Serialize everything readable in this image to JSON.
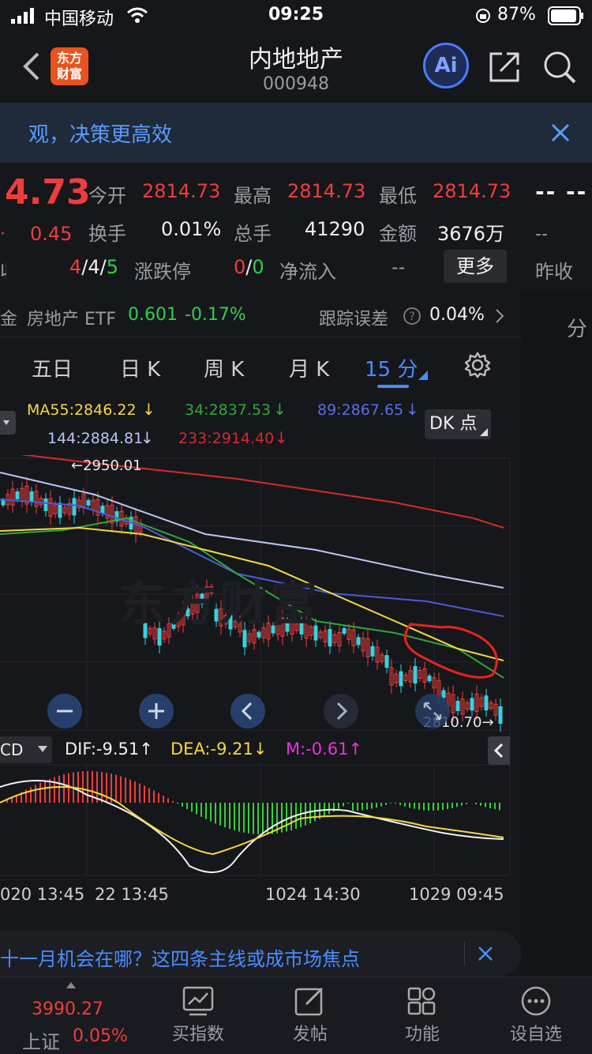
{
  "status": {
    "carrier": "中国移动",
    "time": "09:25",
    "battery": "87%"
  },
  "header": {
    "title": "内地地产",
    "code": "000948",
    "logo_line1": "东方",
    "logo_line2": "财富",
    "ai_label": "Ai"
  },
  "banner": {
    "text": "观，决策更高效"
  },
  "quote": {
    "price": "4.73",
    "change": "0.45",
    "open_label": "今开",
    "open": "2814.73",
    "high_label": "最高",
    "high": "2814.73",
    "low_label": "最低",
    "low": "2814.73",
    "turnover_label": "换手",
    "turnover": "0.01%",
    "volume_label": "总手",
    "volume": "41290",
    "amount_label": "金额",
    "amount": "3676万",
    "ratio_a": "4",
    "ratio_b": "4",
    "ratio_c": "5",
    "limit_label": "涨跌停",
    "limit_a": "0",
    "limit_b": "0",
    "netflow_label": "净流入",
    "netflow": "--",
    "more_label": "更多",
    "right_top": "-- --",
    "right_mid": "--",
    "prev_close_label": "昨收",
    "left_cut": "收"
  },
  "etf": {
    "prefix": "金",
    "name": "房地产 ETF",
    "price": "0.601",
    "pct": "-0.17%",
    "err_label": "跟踪误差",
    "err_value": "0.04%",
    "right_cut": "分"
  },
  "tabs": [
    {
      "label": "五日"
    },
    {
      "label": "日 K"
    },
    {
      "label": "周 K"
    },
    {
      "label": "月 K"
    },
    {
      "label": "15 分"
    }
  ],
  "ma": {
    "ma55": "MA55:2846.22",
    "ma34": "34:2837.53",
    "ma89": "89:2867.65",
    "ma144": "144:2884.81",
    "ma233": "233:2914.40",
    "dk_label": "DK 点",
    "colors": {
      "ma55": "#f5d742",
      "ma34": "#2fa83a",
      "ma89": "#4a5bd8",
      "ma144": "#b9c6f2",
      "ma233": "#d62a2a"
    }
  },
  "chart": {
    "high_marker": "2950.01",
    "low_marker": "2810.70",
    "watermark": "东方财富",
    "macd_label": "CD",
    "dif": "DIF:-9.51",
    "dea": "DEA:-9.21",
    "m": "M:-0.61",
    "time_labels": [
      "020 13:45",
      "22 13:45",
      "1024 14:30",
      "1029 09:45"
    ],
    "controls": [
      "zoom-out",
      "zoom-in",
      "prev",
      "next"
    ]
  },
  "news": {
    "text": "十一月机会在哪？这四条主线或成市场焦点"
  },
  "bottom": {
    "index_value": "3990.27",
    "index_name": "上证",
    "index_pct": "0.05%",
    "items": [
      {
        "label": "买指数"
      },
      {
        "label": "发帖"
      },
      {
        "label": "功能"
      },
      {
        "label": "设自选"
      }
    ]
  }
}
